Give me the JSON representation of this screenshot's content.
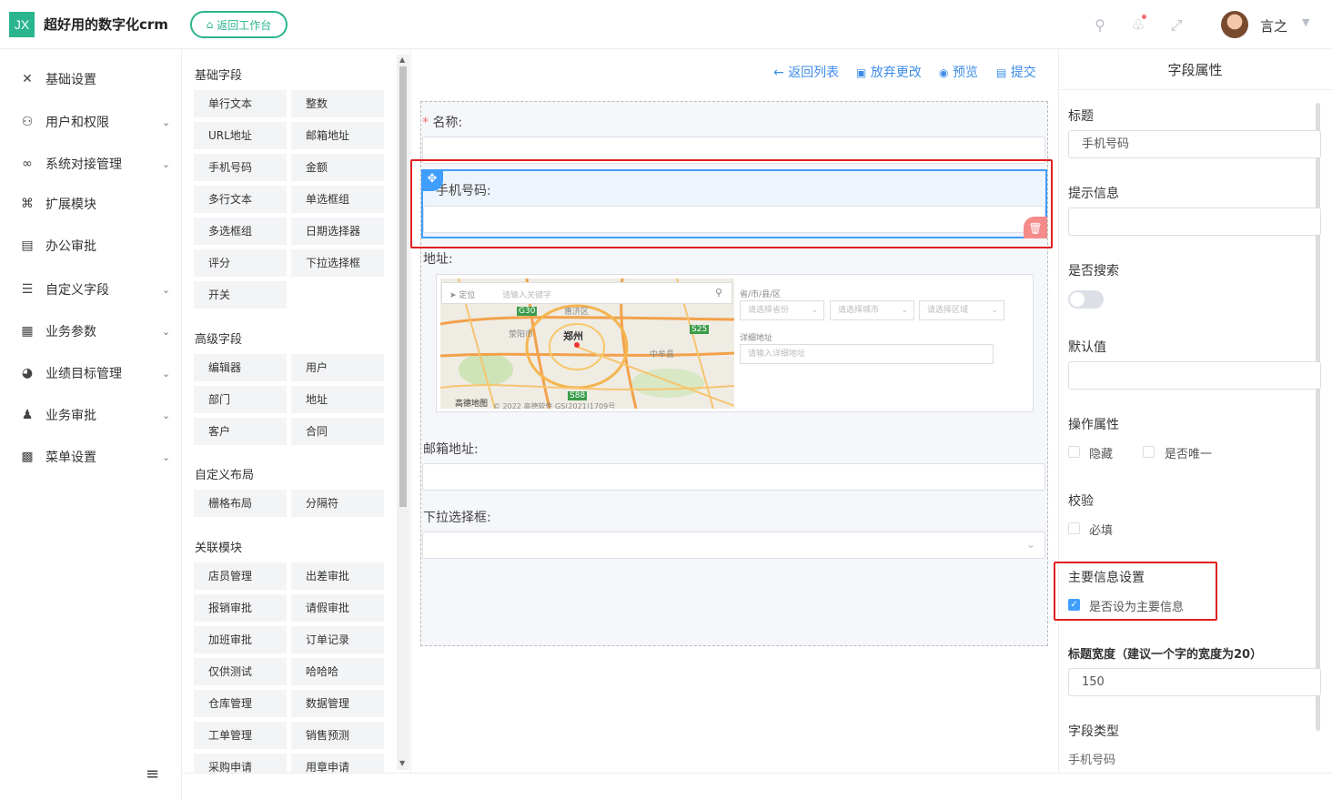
{
  "header": {
    "logo_text": "JX",
    "app_title": "超好用的数字化crm",
    "back_label": "返回工作台",
    "user_name": "言之",
    "accent": "#2bb58f"
  },
  "sidebar": {
    "items": [
      {
        "label": "基础设置",
        "icon": "tools-icon",
        "has_children": false
      },
      {
        "label": "用户和权限",
        "icon": "user-key-icon",
        "has_children": true
      },
      {
        "label": "系统对接管理",
        "icon": "connect-icon",
        "has_children": true
      },
      {
        "label": "扩展模块",
        "icon": "command-icon",
        "has_children": false
      },
      {
        "label": "办公审批",
        "icon": "document-icon",
        "has_children": false
      },
      {
        "label": "自定义字段",
        "icon": "list-icon",
        "has_children": true
      },
      {
        "label": "业务参数",
        "icon": "grid-icon",
        "has_children": true
      },
      {
        "label": "业绩目标管理",
        "icon": "target-icon",
        "has_children": true
      },
      {
        "label": "业务审批",
        "icon": "stamp-icon",
        "has_children": true
      },
      {
        "label": "菜单设置",
        "icon": "menu-blocks-icon",
        "has_children": true
      }
    ]
  },
  "palette": {
    "basic_title": "基础字段",
    "basic": [
      "单行文本",
      "整数",
      "URL地址",
      "邮箱地址",
      "手机号码",
      "金额",
      "多行文本",
      "单选框组",
      "多选框组",
      "日期选择器",
      "评分",
      "下拉选择框",
      "开关"
    ],
    "advanced_title": "高级字段",
    "advanced": [
      "编辑器",
      "用户",
      "部门",
      "地址",
      "客户",
      "合同"
    ],
    "layout_title": "自定义布局",
    "layout": [
      "栅格布局",
      "分隔符"
    ],
    "related_title": "关联模块",
    "related": [
      "店员管理",
      "出差审批",
      "报销审批",
      "请假审批",
      "加班审批",
      "订单记录",
      "仅供测试",
      "哈哈哈",
      "仓库管理",
      "数据管理",
      "工单管理",
      "销售预测",
      "采购申请",
      "用章申请"
    ]
  },
  "toolbar": {
    "back_list": "返回列表",
    "discard": "放弃更改",
    "preview": "预览",
    "submit": "提交"
  },
  "form": {
    "name_label": "名称:",
    "phone_label": "手机号码:",
    "address_label": "地址:",
    "email_label": "邮箱地址:",
    "select_label": "下拉选择框:",
    "map": {
      "locate": "定位",
      "search_placeholder": "请输入关键字",
      "region_label": "省/市/县/区",
      "province_placeholder": "请选择省份",
      "city_placeholder": "请选择城市",
      "district_placeholder": "请选择区域",
      "detail_label": "详细地址",
      "detail_placeholder": "请输入详细地址",
      "city_name": "郑州",
      "place_1": "惠济区",
      "place_2": "荥阳市",
      "place_3": "中牟县",
      "road_1": "G30",
      "road_2": "S25",
      "road_3": "S88",
      "brand": "高德地图",
      "copyright": "© 2022 高德软件 GS(2021)1709号"
    }
  },
  "props": {
    "header": "字段属性",
    "title_label": "标题",
    "title_value": "手机号码",
    "hint_label": "提示信息",
    "searchable_label": "是否搜索",
    "default_label": "默认值",
    "ops_label": "操作属性",
    "hidden_label": "隐藏",
    "unique_label": "是否唯一",
    "validate_label": "校验",
    "required_label": "必填",
    "main_info_label": "主要信息设置",
    "main_info_checkbox": "是否设为主要信息",
    "title_width_label": "标题宽度（建议一个字的宽度为20）",
    "title_width_value": "150",
    "field_type_label": "字段类型",
    "field_type_value": "手机号码"
  }
}
